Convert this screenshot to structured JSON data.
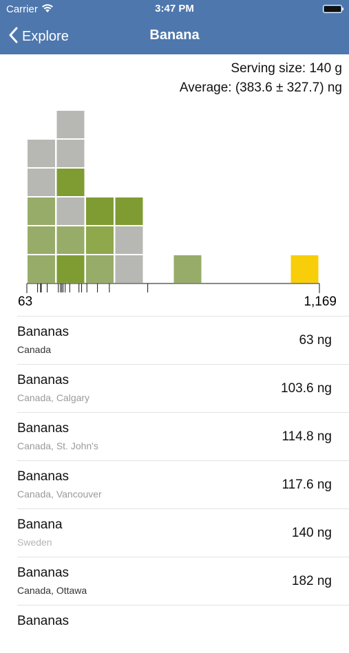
{
  "status": {
    "carrier": "Carrier",
    "time": "3:47 PM"
  },
  "nav": {
    "back_label": "Explore",
    "title": "Banana"
  },
  "summary": {
    "serving": "Serving size: 140 g",
    "average": "Average: (383.6 ± 327.7) ng"
  },
  "range": {
    "min": "63",
    "max": "1,169"
  },
  "colors": {
    "nav": "#4e77ad",
    "gray": "#b7b8b3",
    "olive": "#7f9c33",
    "olive_mid": "#8ea84b",
    "olive_light": "#98ac6a",
    "highlight": "#f7ce09"
  },
  "histogram": {
    "columns": [
      [
        "olive_light",
        "olive_light",
        "olive_light",
        "gray",
        "gray"
      ],
      [
        "olive",
        "olive_light",
        "gray",
        "olive",
        "gray",
        "gray"
      ],
      [
        "olive_light",
        "olive_mid",
        "olive"
      ],
      [
        "gray",
        "gray",
        "olive"
      ],
      [],
      [
        "olive_light"
      ],
      [],
      [],
      [],
      [
        "highlight"
      ]
    ],
    "ticks": [
      63,
      103.6,
      114.8,
      117.6,
      140,
      182,
      190,
      195,
      200,
      208,
      225,
      260,
      270,
      290,
      330,
      375,
      520
    ]
  },
  "items": [
    {
      "name": "Bananas",
      "location": "Canada",
      "loc_color": "#333333",
      "value": "63 ng"
    },
    {
      "name": "Bananas",
      "location": "Canada, Calgary",
      "loc_color": "#9a9a9a",
      "value": "103.6 ng"
    },
    {
      "name": "Bananas",
      "location": "Canada, St. John's",
      "loc_color": "#9a9a9a",
      "value": "114.8 ng"
    },
    {
      "name": "Bananas",
      "location": "Canada, Vancouver",
      "loc_color": "#9a9a9a",
      "value": "117.6 ng"
    },
    {
      "name": "Banana",
      "location": "Sweden",
      "loc_color": "#b5b5b5",
      "value": "140 ng"
    },
    {
      "name": "Bananas",
      "location": "Canada, Ottawa",
      "loc_color": "#333333",
      "value": "182 ng"
    },
    {
      "name": "Bananas",
      "location": "",
      "loc_color": "#9a9a9a",
      "value": ""
    }
  ]
}
